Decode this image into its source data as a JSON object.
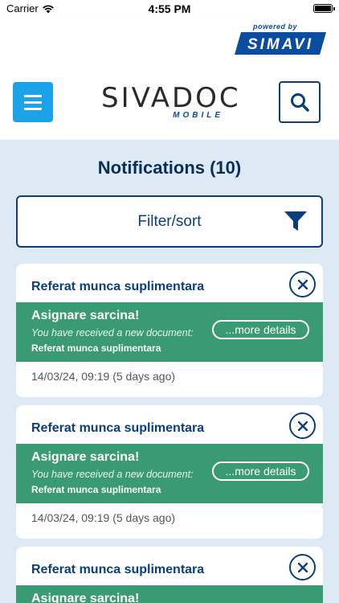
{
  "status_bar": {
    "carrier": "Carrier",
    "time": "4:55 PM"
  },
  "powered_by": {
    "text": "powered by",
    "brand": "SIMAVI"
  },
  "header": {
    "brand_main": "SIVADOC",
    "brand_sub": "MOBILE"
  },
  "page": {
    "title": "Notifications (10)"
  },
  "filter": {
    "label": "Filter/sort"
  },
  "notifications": [
    {
      "title": "Referat munca suplimentara",
      "heading": "Asignare sarcina!",
      "subtitle": "You have received a new document:",
      "document": "Referat munca suplimentara",
      "more_label": "...more details",
      "time": "14/03/24, 09:19 (5 days ago)"
    },
    {
      "title": "Referat munca suplimentara",
      "heading": "Asignare sarcina!",
      "subtitle": "You have received a new document:",
      "document": "Referat munca suplimentara",
      "more_label": "...more details",
      "time": "14/03/24, 09:19 (5 days ago)"
    },
    {
      "title": "Referat munca suplimentara",
      "heading": "Asignare sarcina!",
      "subtitle": "",
      "document": "",
      "more_label": "",
      "time": ""
    }
  ],
  "colors": {
    "accent": "#1aa3e8",
    "navy": "#0a3f7a",
    "green": "#3a9a72",
    "background": "#dde9f4"
  }
}
